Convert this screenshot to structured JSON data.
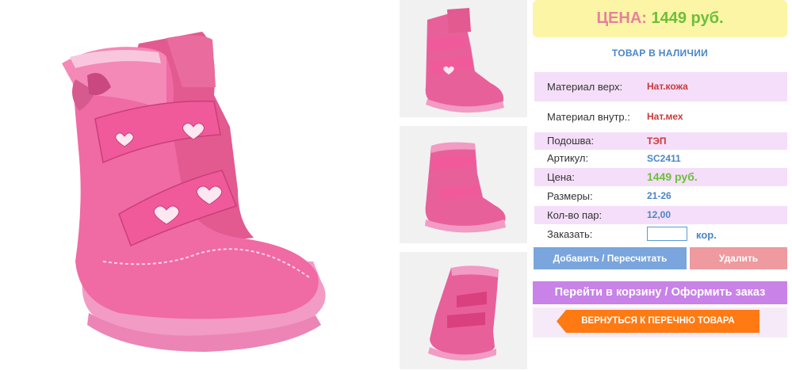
{
  "product": {
    "main_image": "pink-winter-boot-photo",
    "thumbnails": [
      "boot-front-view",
      "boot-side-view",
      "boot-back-view"
    ]
  },
  "price_banner": {
    "label": "ЦЕНА:",
    "value": "1449 руб."
  },
  "stock_status": "ТОВАР В НАЛИЧИИ",
  "specs": [
    {
      "key": "Материал верх:",
      "value": "Нат.кожа"
    },
    {
      "key": "Материал внутр.:",
      "value": "Нат.мех"
    },
    {
      "key": "Подошва:",
      "value": "ТЭП"
    },
    {
      "key": "Артикул:",
      "value": "SC2411"
    },
    {
      "key": "Цена:",
      "value": "1449 руб."
    },
    {
      "key": "Размеры:",
      "value": "21-26"
    },
    {
      "key": "Кол-во пар:",
      "value": "12,00"
    }
  ],
  "order": {
    "label": "Заказать:",
    "quantity": "",
    "unit": "кор."
  },
  "buttons": {
    "add": "Добавить / Пересчитать",
    "delete": "Удалить",
    "cart": "Перейти в корзину / Оформить заказ",
    "back": "ВЕРНУТЬСЯ К ПЕРЕЧНЮ ТОВАРА"
  },
  "colors": {
    "spec_row_shade": "#f5def9",
    "price_label": "#e4839c",
    "price_value": "#6cbf3b",
    "accent_blue": "#4a86c5",
    "add_button": "#7aa5dd",
    "delete_button": "#ee9a9e",
    "cart_button": "#c882e8",
    "back_button": "#ff7a12"
  }
}
